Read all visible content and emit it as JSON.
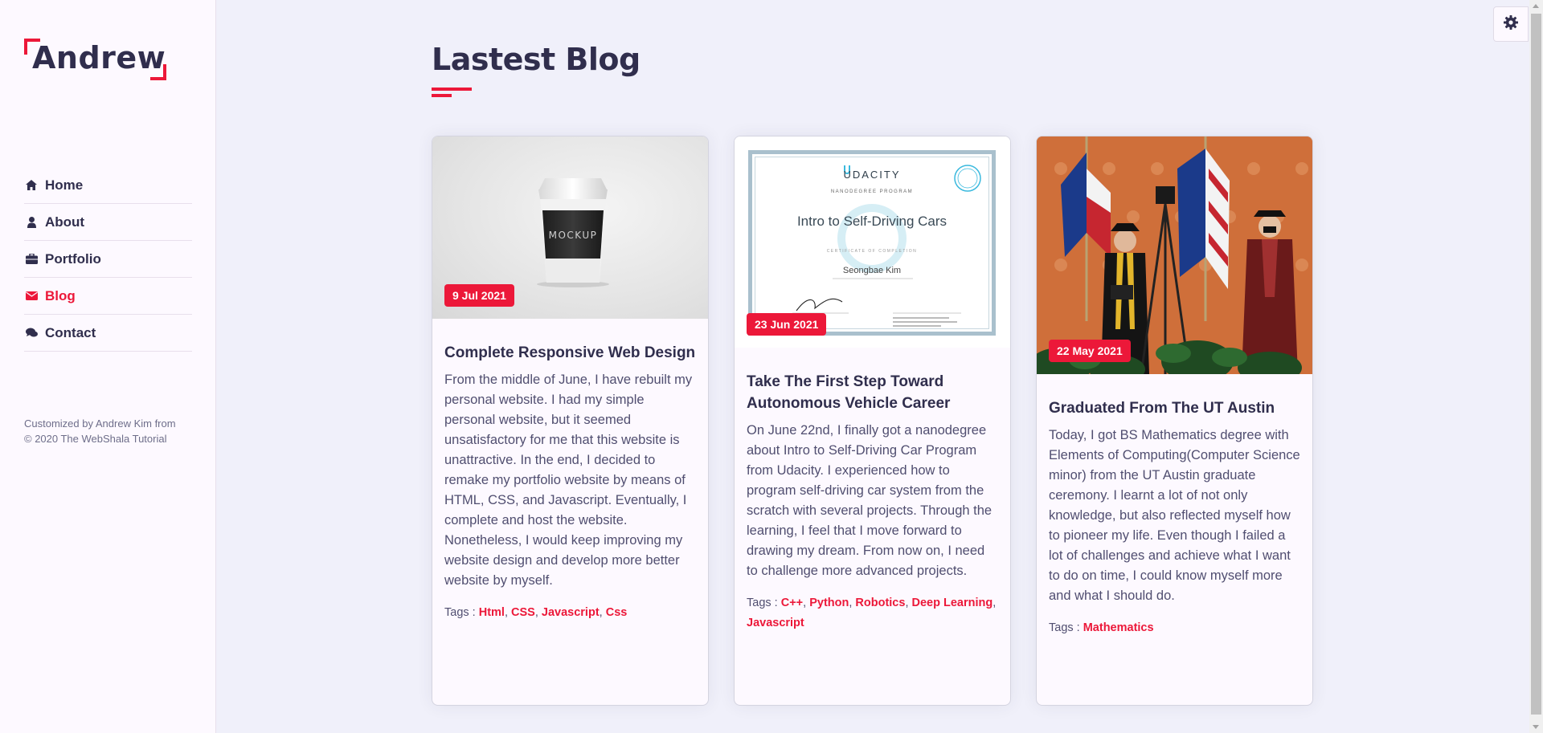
{
  "sidebar": {
    "logo": "Andrew",
    "nav": [
      {
        "label": "Home",
        "icon": "home-icon",
        "active": false
      },
      {
        "label": "About",
        "icon": "user-icon",
        "active": false
      },
      {
        "label": "Portfolio",
        "icon": "briefcase-icon",
        "active": false
      },
      {
        "label": "Blog",
        "icon": "envelope-icon",
        "active": true
      },
      {
        "label": "Contact",
        "icon": "comments-icon",
        "active": false
      }
    ],
    "copyright": "Customized by Andrew Kim from © 2020 The WebShala Tutorial"
  },
  "section": {
    "title": "Lastest Blog"
  },
  "posts": [
    {
      "date": "9 Jul 2021",
      "title": "Complete Responsive Web Design",
      "image": "coffee-cup-mockup",
      "image_text": "MOCKUP",
      "text": "From the middle of June, I have rebuilt my personal website. I had my simple personal website, but it seemed unsatisfactory for me that this website is unattractive. In the end, I decided to remake my portfolio website by means of HTML, CSS, and Javascript. Eventually, I complete and host the website. Nonetheless, I would keep improving my website design and develop more better website by myself.",
      "tags_label": "Tags :",
      "tags": [
        "Html",
        "CSS",
        "Javascript",
        "Css"
      ]
    },
    {
      "date": "23 Jun 2021",
      "title": "Take The First Step Toward Autonomous Vehicle Career",
      "image": "udacity-certificate",
      "certificate": {
        "brand": "UDACITY",
        "program": "NANODEGREE PROGRAM",
        "course": "Intro to Self-Driving Cars",
        "subtitle": "CERTIFICATE OF COMPLETION",
        "name": "Seongbae Kim"
      },
      "text": "On June 22nd, I finally got a nanodegree about Intro to Self-Driving Car Program from Udacity. I experienced how to program self-driving car system from the scratch with several projects. Through the learning, I feel that I move forward to drawing my dream. From now on, I need to challenge more advanced projects.",
      "tags_label": "Tags :",
      "tags": [
        "C++",
        "Python",
        "Robotics",
        "Deep Learning",
        "Javascript"
      ]
    },
    {
      "date": "22 May 2021",
      "title": "Graduated From The UT Austin",
      "image": "graduation-photo",
      "text": "Today, I got BS Mathematics degree with Elements of Computing(Computer Science minor) from the UT Austin graduate ceremony. I learnt a lot of not only knowledge, but also reflected myself how to pioneer my life. Even though I failed a lot of challenges and achieve what I want to do on time, I could know myself more and what I should do.",
      "tags_label": "Tags :",
      "tags": [
        "Mathematics"
      ]
    }
  ],
  "colors": {
    "accent": "#ec1839",
    "text_dark": "#302e4d",
    "bg_main": "#f0f0fa",
    "bg_sidebar": "#fdf9ff"
  },
  "settings": {
    "icon": "gear-icon"
  }
}
